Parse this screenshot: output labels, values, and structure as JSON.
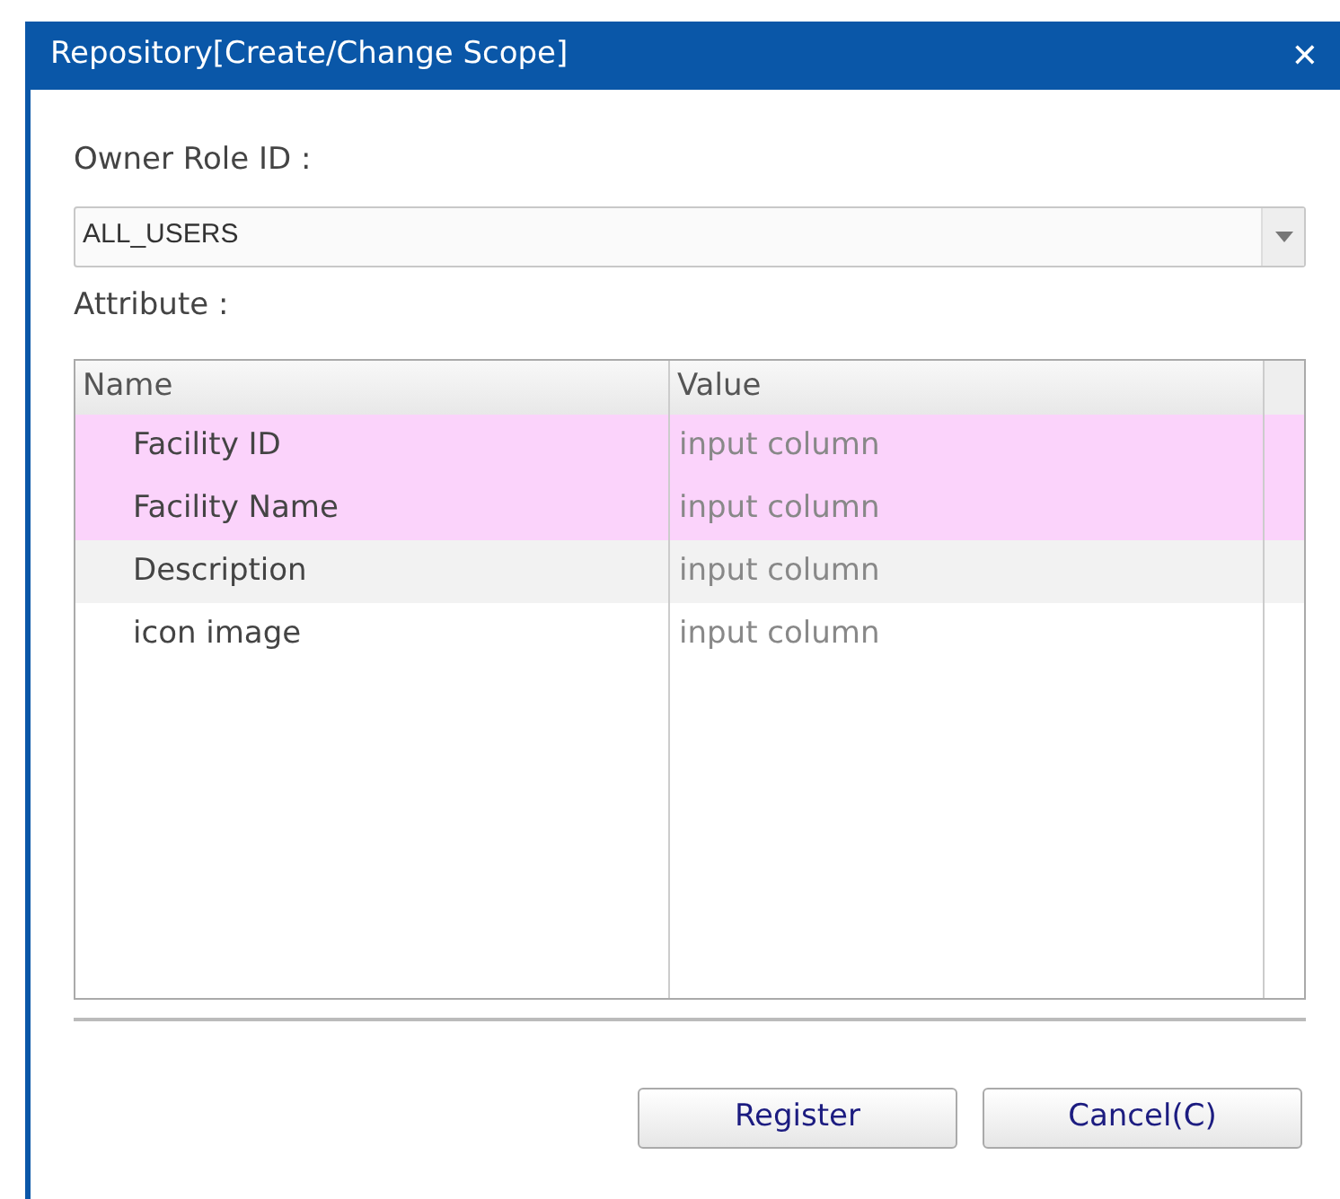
{
  "window": {
    "title": "Repository[Create/Change Scope]",
    "close": "✕"
  },
  "owner_role": {
    "label": "Owner Role ID :",
    "value": "ALL_USERS"
  },
  "attribute": {
    "label": "Attribute :"
  },
  "table": {
    "columns": [
      "Name",
      "Value"
    ],
    "rows": [
      {
        "name": "Facility ID",
        "value": "input column",
        "selected": true
      },
      {
        "name": "Facility Name",
        "value": "input column",
        "selected": true
      },
      {
        "name": "Description",
        "value": "input column",
        "selected": false
      },
      {
        "name": "icon image",
        "value": "input column",
        "selected": false
      }
    ]
  },
  "buttons": [
    "Register",
    "Cancel(C)"
  ]
}
